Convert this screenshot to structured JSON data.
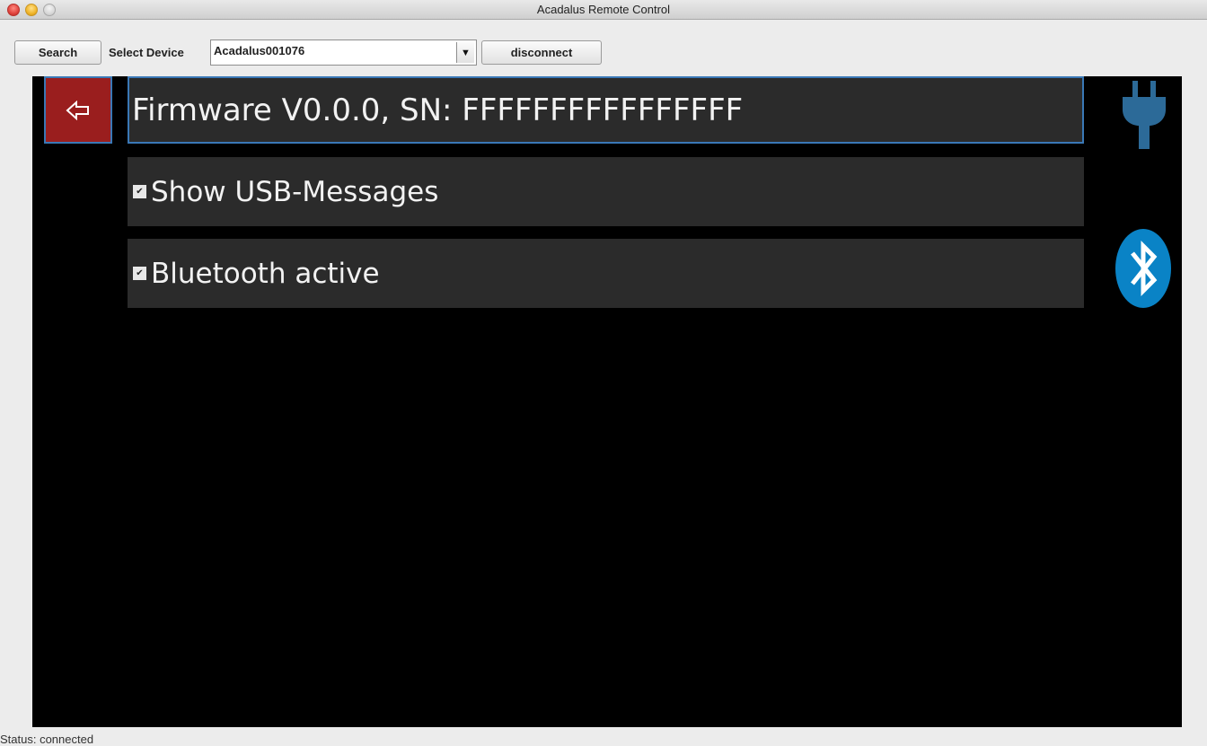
{
  "window": {
    "title": "Acadalus Remote Control"
  },
  "toolbar": {
    "search_label": "Search",
    "select_device_label": "Select Device",
    "selected_device": "Acadalus001076",
    "disconnect_label": "disconnect"
  },
  "main": {
    "firmware_text": "Firmware V0.0.0, SN: FFFFFFFFFFFFFFFF",
    "show_usb_label": "Show USB-Messages",
    "show_usb_checked": true,
    "bluetooth_label": "Bluetooth active",
    "bluetooth_checked": true,
    "icons": {
      "back": "back-arrow-icon",
      "usb": "plug-icon",
      "bluetooth": "bluetooth-icon"
    },
    "colors": {
      "back_button": "#9a1e1e",
      "accent_blue": "#2c6a98",
      "bluetooth_blue": "#0a83c6"
    }
  },
  "status": {
    "text": "Status: connected"
  }
}
